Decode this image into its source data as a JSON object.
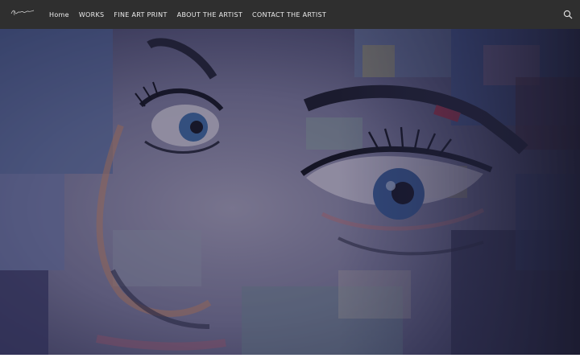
{
  "header": {
    "nav_items": [
      {
        "label": "Home"
      },
      {
        "label": "WORKS"
      },
      {
        "label": "FINE ART PRINT"
      },
      {
        "label": "ABOUT THE ARTIST"
      },
      {
        "label": "CONTACT THE ARTIST"
      }
    ],
    "logo_icon": "signature-logo",
    "search_icon": "search-icon"
  },
  "hero": {
    "image": "painting-of-a-woman-face-close-up",
    "overlay_color": "#1e1e30"
  },
  "colors": {
    "navbar_bg": "#2f2f2f",
    "nav_text": "#ececec"
  }
}
